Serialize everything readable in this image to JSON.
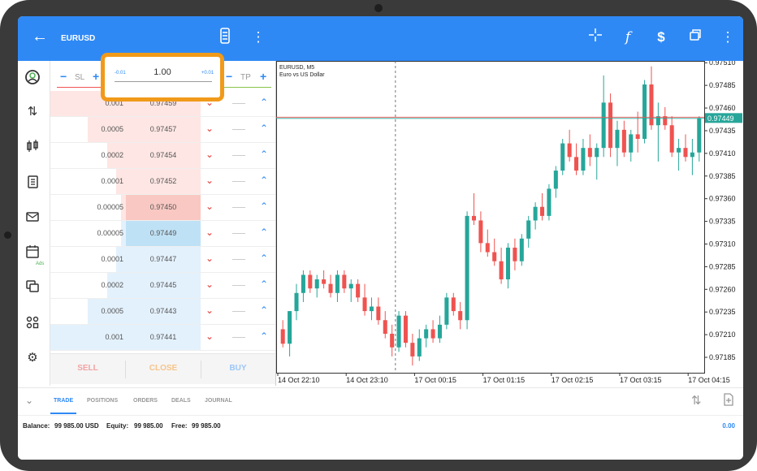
{
  "topbar": {
    "symbol": "EURUSD",
    "icons": [
      "back-arrow-icon",
      "one-click-trading-icon",
      "more-vert-icon",
      "crosshair-icon",
      "indicators-icon",
      "trade-symbol-icon",
      "windows-icon",
      "more-vert-icon"
    ]
  },
  "leftnav": {
    "icons": [
      "quotes-icon",
      "trade-icon",
      "chart-icon",
      "history-icon",
      "messages-icon",
      "calendar-icon",
      "chat-icon",
      "community-icon",
      "settings-icon"
    ],
    "ads_label": "Ads"
  },
  "order_panel": {
    "sl_label": "SL",
    "tp_label": "TP",
    "volume": "1.00",
    "volume_minus": "-0.01",
    "volume_plus": "+0.01",
    "rows": [
      {
        "volume": "0.001",
        "price": "0.97459",
        "side": "ask"
      },
      {
        "volume": "0.0005",
        "price": "0.97457",
        "side": "ask"
      },
      {
        "volume": "0.0002",
        "price": "0.97454",
        "side": "ask"
      },
      {
        "volume": "0.0001",
        "price": "0.97452",
        "side": "ask"
      },
      {
        "volume": "0.00005",
        "price": "0.97450",
        "side": "ask-best"
      },
      {
        "volume": "0.00005",
        "price": "0.97449",
        "side": "bid-best"
      },
      {
        "volume": "0.0001",
        "price": "0.97447",
        "side": "bid"
      },
      {
        "volume": "0.0002",
        "price": "0.97445",
        "side": "bid"
      },
      {
        "volume": "0.0005",
        "price": "0.97443",
        "side": "bid"
      },
      {
        "volume": "0.001",
        "price": "0.97441",
        "side": "bid"
      }
    ],
    "sell_label": "SELL",
    "close_label": "CLOSE",
    "buy_label": "BUY"
  },
  "chart_data": {
    "type": "candlestick",
    "title": "EURUSD, M5",
    "subtitle": "Euro vs US Dollar",
    "current_price": "0.97449",
    "y_ticks": [
      "0.97510",
      "0.97485",
      "0.97460",
      "0.97435",
      "0.97410",
      "0.97385",
      "0.97360",
      "0.97335",
      "0.97310",
      "0.97285",
      "0.97260",
      "0.97235",
      "0.97210",
      "0.97185"
    ],
    "ylim": [
      0.97168,
      0.97512
    ],
    "x_ticks": [
      "14 Oct 22:10",
      "14 Oct 23:10",
      "17 Oct 00:15",
      "17 Oct 01:15",
      "17 Oct 02:15",
      "17 Oct 03:15",
      "17 Oct 04:15"
    ],
    "candles": [
      [
        0.97216,
        0.97226,
        0.97196,
        0.972
      ],
      [
        0.972,
        0.97236,
        0.97186,
        0.97236
      ],
      [
        0.97236,
        0.97266,
        0.97226,
        0.97256
      ],
      [
        0.97256,
        0.97281,
        0.97246,
        0.97276
      ],
      [
        0.97276,
        0.97281,
        0.97256,
        0.97261
      ],
      [
        0.97261,
        0.97276,
        0.97251,
        0.97271
      ],
      [
        0.97271,
        0.97281,
        0.97261,
        0.97266
      ],
      [
        0.97266,
        0.97276,
        0.97251,
        0.97256
      ],
      [
        0.97256,
        0.97281,
        0.97246,
        0.97276
      ],
      [
        0.97276,
        0.97281,
        0.97256,
        0.97261
      ],
      [
        0.97261,
        0.97271,
        0.97246,
        0.97266
      ],
      [
        0.97266,
        0.97271,
        0.97246,
        0.97251
      ],
      [
        0.97251,
        0.97266,
        0.97231,
        0.97236
      ],
      [
        0.97236,
        0.97251,
        0.97226,
        0.97241
      ],
      [
        0.97241,
        0.97251,
        0.97221,
        0.97226
      ],
      [
        0.97226,
        0.97236,
        0.97206,
        0.97211
      ],
      [
        0.97211,
        0.97221,
        0.97186,
        0.97196
      ],
      [
        0.97196,
        0.97236,
        0.97191,
        0.97231
      ],
      [
        0.97231,
        0.97236,
        0.97196,
        0.97201
      ],
      [
        0.97201,
        0.97211,
        0.97176,
        0.97186
      ],
      [
        0.97186,
        0.97216,
        0.97181,
        0.97206
      ],
      [
        0.97206,
        0.97221,
        0.97196,
        0.97216
      ],
      [
        0.97216,
        0.97226,
        0.97201,
        0.97206
      ],
      [
        0.97206,
        0.97231,
        0.97201,
        0.97221
      ],
      [
        0.97221,
        0.97256,
        0.97216,
        0.97251
      ],
      [
        0.97251,
        0.97256,
        0.97231,
        0.97236
      ],
      [
        0.97236,
        0.97246,
        0.97216,
        0.97226
      ],
      [
        0.97226,
        0.97346,
        0.97216,
        0.97341
      ],
      [
        0.97341,
        0.97366,
        0.97331,
        0.97336
      ],
      [
        0.97336,
        0.97346,
        0.97301,
        0.97311
      ],
      [
        0.97311,
        0.97326,
        0.97296,
        0.97301
      ],
      [
        0.97301,
        0.97316,
        0.97286,
        0.97291
      ],
      [
        0.97291,
        0.97306,
        0.97266,
        0.97271
      ],
      [
        0.97271,
        0.97311,
        0.97261,
        0.97306
      ],
      [
        0.97306,
        0.97316,
        0.97281,
        0.97291
      ],
      [
        0.97291,
        0.97321,
        0.97286,
        0.97316
      ],
      [
        0.97316,
        0.97341,
        0.97306,
        0.97336
      ],
      [
        0.97336,
        0.97356,
        0.97326,
        0.97351
      ],
      [
        0.97351,
        0.97366,
        0.97336,
        0.97341
      ],
      [
        0.97341,
        0.97376,
        0.97336,
        0.97371
      ],
      [
        0.97371,
        0.97396,
        0.97361,
        0.97391
      ],
      [
        0.97391,
        0.97426,
        0.97386,
        0.97421
      ],
      [
        0.97421,
        0.97436,
        0.97401,
        0.97406
      ],
      [
        0.97406,
        0.97421,
        0.97386,
        0.97391
      ],
      [
        0.97391,
        0.97426,
        0.97386,
        0.97416
      ],
      [
        0.97416,
        0.97431,
        0.97396,
        0.97406
      ],
      [
        0.97406,
        0.97421,
        0.97381,
        0.97416
      ],
      [
        0.97416,
        0.97496,
        0.97406,
        0.97466
      ],
      [
        0.97466,
        0.97476,
        0.97406,
        0.97416
      ],
      [
        0.97416,
        0.97446,
        0.97396,
        0.97436
      ],
      [
        0.97436,
        0.97446,
        0.97406,
        0.97411
      ],
      [
        0.97411,
        0.97436,
        0.97401,
        0.97431
      ],
      [
        0.97431,
        0.97456,
        0.97411,
        0.97426
      ],
      [
        0.97426,
        0.97491,
        0.97421,
        0.97486
      ],
      [
        0.97486,
        0.97506,
        0.97436,
        0.97441
      ],
      [
        0.97441,
        0.97466,
        0.97401,
        0.97451
      ],
      [
        0.97451,
        0.97461,
        0.97436,
        0.97441
      ],
      [
        0.97441,
        0.97451,
        0.97406,
        0.97411
      ],
      [
        0.97411,
        0.97426,
        0.97391,
        0.97416
      ],
      [
        0.97416,
        0.97431,
        0.97401,
        0.97406
      ],
      [
        0.97406,
        0.97426,
        0.97386,
        0.97411
      ],
      [
        0.97411,
        0.97451,
        0.97401,
        0.97449
      ]
    ]
  },
  "bottom": {
    "tabs": [
      "TRADE",
      "POSITIONS",
      "ORDERS",
      "DEALS",
      "JOURNAL"
    ],
    "active_tab": "TRADE",
    "balance_label": "Balance:",
    "balance": "99 985.00 USD",
    "equity_label": "Equity:",
    "equity": "99 985.00",
    "free_label": "Free:",
    "free": "99 985.00",
    "pnl": "0.00"
  },
  "colors": {
    "accent": "#2f89f5",
    "bull": "#26a69a",
    "bear": "#ef5350",
    "highlight": "#f19a1a"
  }
}
